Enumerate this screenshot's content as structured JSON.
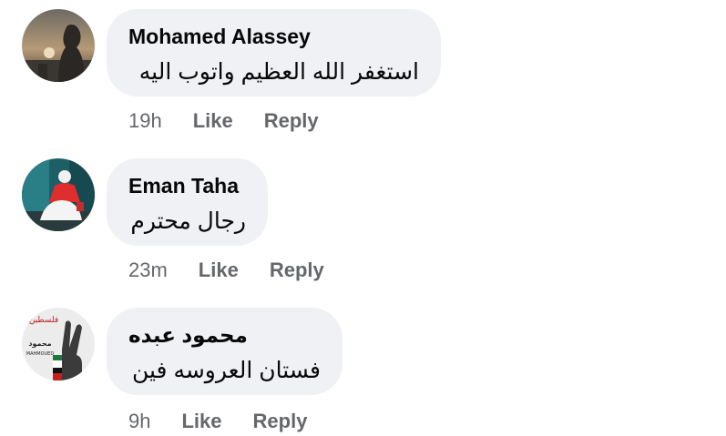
{
  "comments": [
    {
      "author": "Mohamed Alassey",
      "text": "استغفر الله العظيم واتوب اليه",
      "time": "19h",
      "like_label": "Like",
      "reply_label": "Reply"
    },
    {
      "author": "Eman Taha",
      "text": "رجال محترم",
      "time": "23m",
      "like_label": "Like",
      "reply_label": "Reply"
    },
    {
      "author": "محمود عبده",
      "text": "فستان العروسه فين",
      "time": "9h",
      "like_label": "Like",
      "reply_label": "Reply",
      "avatar_text": {
        "line1": "فلسطين",
        "line2": "محمود",
        "line3": "MAHMOUED"
      }
    }
  ],
  "colors": {
    "bubble": "#eff1f4",
    "name": "#080809",
    "meta": "#65676b"
  }
}
